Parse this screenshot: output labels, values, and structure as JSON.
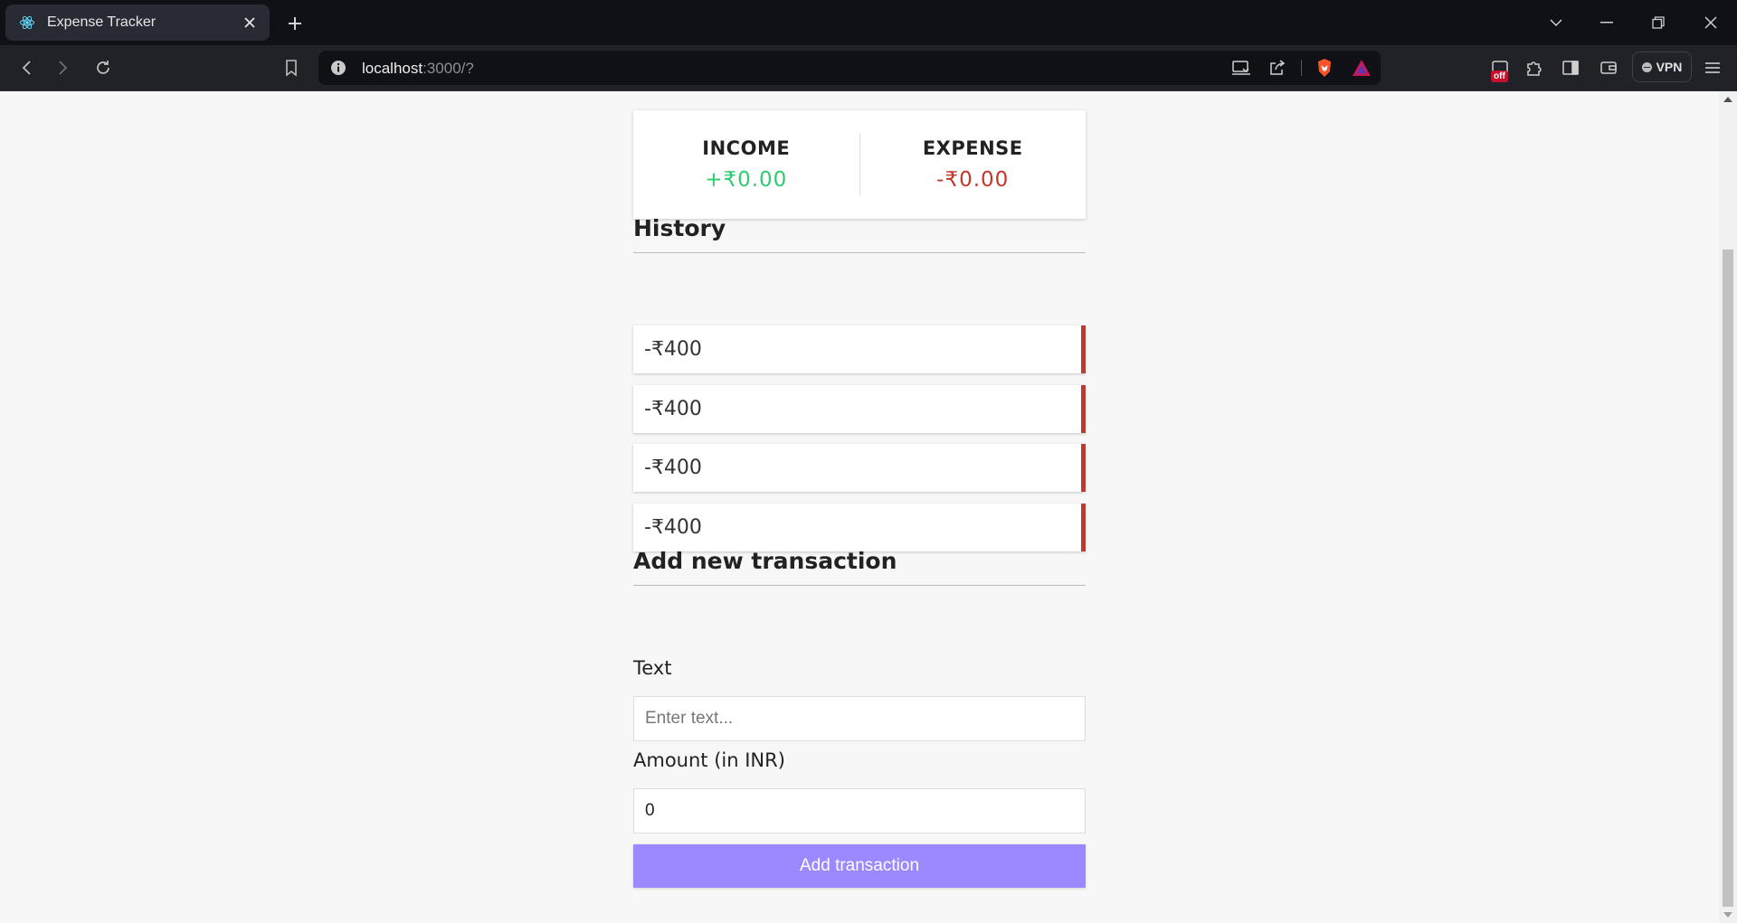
{
  "browser": {
    "tab_title": "Expense Tracker",
    "url_host": "localhost",
    "url_rest": ":3000/?",
    "shields_badge": "off",
    "vpn_label": "VPN"
  },
  "summary": {
    "income_label": "INCOME",
    "income_value": "+₹0.00",
    "expense_label": "EXPENSE",
    "expense_value": "-₹0.00"
  },
  "history": {
    "heading": "History",
    "items": [
      {
        "amount": "-₹400"
      },
      {
        "amount": "-₹400"
      },
      {
        "amount": "-₹400"
      },
      {
        "amount": "-₹400"
      }
    ]
  },
  "form": {
    "heading": "Add new transaction",
    "text_label": "Text",
    "text_placeholder": "Enter text...",
    "amount_label": "Amount (in INR)",
    "amount_value": "0",
    "submit_label": "Add transaction"
  },
  "colors": {
    "income": "#2ecc71",
    "expense": "#c0392b",
    "button": "#9c88ff"
  }
}
